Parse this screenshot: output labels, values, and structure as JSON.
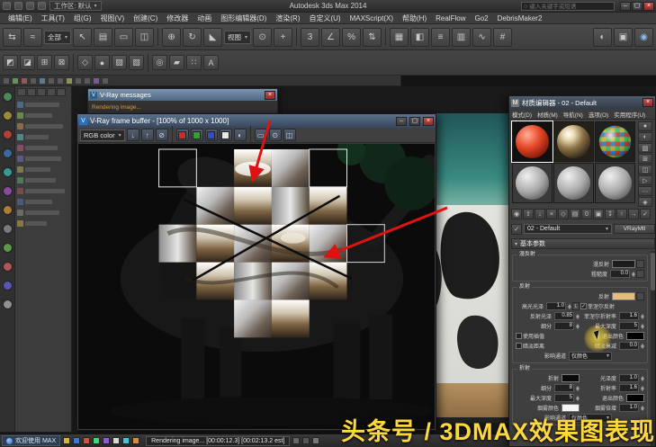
{
  "titlebar": {
    "workspace": "工作区: 默认",
    "title": "Autodesk 3ds Max 2014",
    "search_placeholder": "键入关键字或短语"
  },
  "menubar": {
    "items": [
      "编辑(E)",
      "工具(T)",
      "组(G)",
      "视图(V)",
      "创建(C)",
      "修改器",
      "动画",
      "图形编辑器(D)",
      "渲染(R)",
      "自定义(U)",
      "MAXScript(X)",
      "帮助(H)",
      "RealFlow",
      "Go2",
      "DebrisMaker2"
    ]
  },
  "toolbar": {
    "selection_filter": "全部",
    "coord_system": "视图",
    "snap_mode": "3"
  },
  "vray_messages": {
    "title": "V-Ray messages",
    "log_line": "Rendering image..."
  },
  "frame_buffer": {
    "title": "V-Ray frame buffer - [100% of 1000 x 1000]",
    "channel_selector": "RGB color"
  },
  "material_editor": {
    "title": "材质编辑器 - 02 - Default",
    "menus": [
      "模式(D)",
      "材质(M)",
      "导航(N)",
      "选项(O)",
      "实用程序(U)"
    ],
    "material_name": "02 - Default",
    "material_type": "VRayMtl",
    "rollout_basic": "基本参数",
    "groups": {
      "diffuse": "漫反射",
      "reflection": "反射",
      "refraction": "折射"
    },
    "params": {
      "diffuse": {
        "label": "漫反射"
      },
      "roughness": {
        "label": "粗糙度",
        "value": "0.0"
      },
      "reflection": {
        "label": "反射"
      },
      "hilight_gloss": {
        "label": "高光光泽",
        "value": "1.0"
      },
      "refl_gloss": {
        "label": "反射光泽",
        "value": "0.85"
      },
      "subdivs": {
        "label": "细分",
        "value": "8"
      },
      "use_interpolation": {
        "label": "使用插值"
      },
      "fresnel": {
        "label": "菲涅尔反射"
      },
      "fresnel_ior": {
        "label": "菲涅尔折射率",
        "value": "1.6"
      },
      "max_depth": {
        "label": "最大深度",
        "value": "5"
      },
      "exit_color": {
        "label": "退出颜色"
      },
      "dim_distance": {
        "label": "暗淡距离"
      },
      "dim_falloff": {
        "label": "暗淡衰减",
        "value": "0.0"
      },
      "affect_channels": {
        "label": "影响通道",
        "value": "仅颜色"
      },
      "refraction": {
        "label": "折射"
      },
      "glossiness": {
        "label": "光泽度",
        "value": "1.0"
      },
      "refr_subdivs": {
        "label": "细分",
        "value": "8"
      },
      "ior": {
        "label": "折射率",
        "value": "1.6"
      },
      "refr_max_depth": {
        "label": "最大深度",
        "value": "5"
      },
      "refr_exit_color": {
        "label": "退出颜色"
      },
      "fog_color": {
        "label": "烟雾颜色"
      },
      "fog_multiplier": {
        "label": "烟雾倍增",
        "value": "1.0"
      },
      "refr_affect_channels": {
        "label": "影响通道",
        "value": "仅颜色"
      },
      "lock": "L"
    }
  },
  "statusbar": {
    "welcome": "欢迎使用 MAX",
    "progress": "Rendering image... [00:00:12.3] [00:02:13.2 est]"
  },
  "watermark": "头条号 / 3DMAX效果图表现",
  "colors": {
    "reflection_swatch": "#e6bd7e",
    "annotation_arrow": "#de1212",
    "watermark_text": "#ffd83d"
  }
}
